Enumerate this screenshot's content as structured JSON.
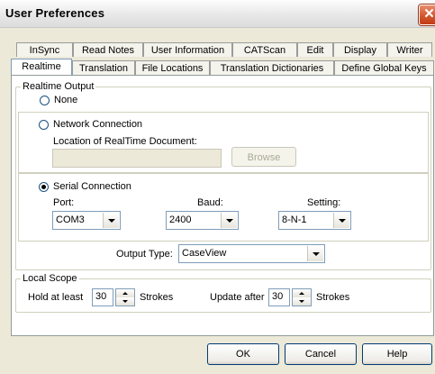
{
  "window": {
    "title": "User Preferences",
    "close_glyph": "✕"
  },
  "tabs_row1": [
    "InSync",
    "Read Notes",
    "User Information",
    "CATScan",
    "Edit",
    "Display",
    "Writer"
  ],
  "tabs_row2": [
    "Realtime",
    "Translation",
    "File Locations",
    "Translation Dictionaries",
    "Define Global Keys"
  ],
  "active_tab": "Realtime",
  "realtime_output": {
    "legend": "Realtime Output",
    "none_label": "None",
    "network_label": "Network Connection",
    "location_label": "Location of RealTime Document:",
    "location_value": "",
    "browse_label": "Browse",
    "serial_label": "Serial Connection",
    "port_label": "Port:",
    "port_value": "COM3",
    "baud_label": "Baud:",
    "baud_value": "2400",
    "setting_label": "Setting:",
    "setting_value": "8-N-1",
    "output_type_label": "Output Type:",
    "output_type_value": "CaseView"
  },
  "local_scope": {
    "legend": "Local Scope",
    "hold_label": "Hold at least",
    "hold_value": "30",
    "strokes1": "Strokes",
    "update_label": "Update after",
    "update_value": "30",
    "strokes2": "Strokes"
  },
  "buttons": {
    "ok": "OK",
    "cancel": "Cancel",
    "help": "Help"
  },
  "icons": {
    "close": "close-icon",
    "dropdown": "chevron-down-icon",
    "spin": "spin-arrows-icon"
  },
  "colors": {
    "face": "#ece9d8",
    "close": "#c23b13",
    "field_border": "#7f9db9"
  }
}
